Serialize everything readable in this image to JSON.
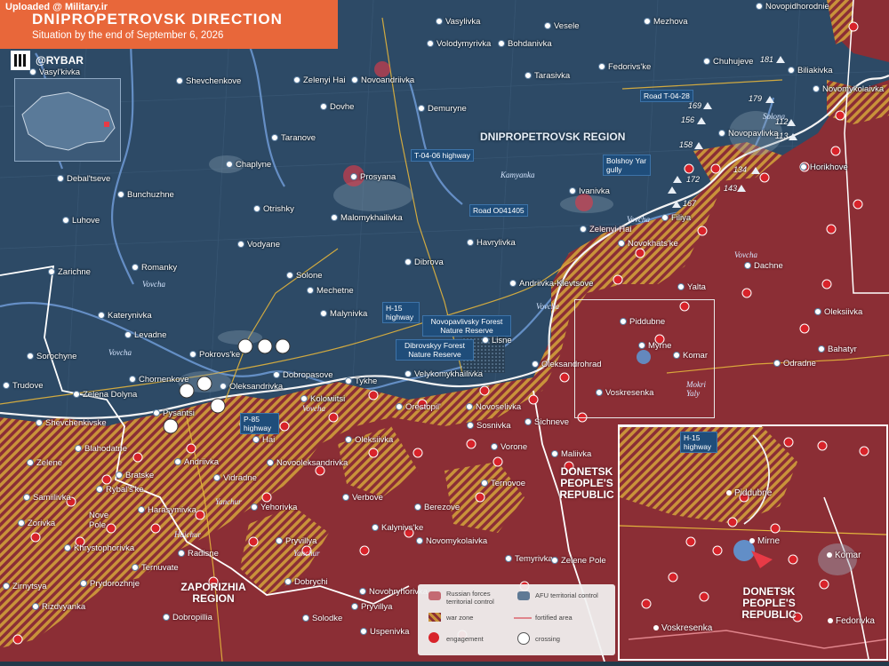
{
  "header": {
    "uploaded": "Uploaded @ Military.ir",
    "title": "DNIPROPETROVSK DIRECTION",
    "subtitle": "Situation by the end of September 6, 2026",
    "brand": "@RYBAR"
  },
  "colors": {
    "afu_territory": "#2d4a66",
    "russian_territory": "#8b2e35",
    "war_zone": "#c9923a",
    "engagement": "#d8232a",
    "header": "#e8673a",
    "roads": "#e2b43c"
  },
  "regions": {
    "dnipropetrovsk": "DNIPROPETROVSK REGION",
    "zaporizhia": "ZAPORIZHIA REGION",
    "donetsk": "DONETSK PEOPLE'S REPUBLIC"
  },
  "roads": {
    "t0406": "T-04-06 highway",
    "t0428": "Road T-04-28",
    "o041405": "Road O041405",
    "h15": "H-15 highway",
    "p85": "P-85 highway",
    "bolshoy": "Bolshoy Yar gully"
  },
  "reserves": {
    "novopavlivsky": "Novopavlivsky Forest Nature Reserve",
    "dibrovsky": "Dibrovskyy Forest Nature Reserve"
  },
  "rivers": [
    "Vovcha",
    "Vovcha",
    "Vovcha",
    "Vovcha",
    "Vovcha",
    "Vovcha",
    "Kamyanka",
    "Solona",
    "Yanchur",
    "Yanchur",
    "Haichur",
    "Mokri Yaly"
  ],
  "hill_numbers": [
    "181",
    "179",
    "169",
    "156",
    "112",
    "113",
    "158",
    "134",
    "172",
    "143",
    "167"
  ],
  "settlements": [
    "Vasyl'kivka",
    "Shevchenkove",
    "Zelenyi Hai",
    "Novoandriivka",
    "Dovhe",
    "Taranove",
    "Vasylivka",
    "Volodymyrivka",
    "Bohdanivka",
    "Vesele",
    "Mezhova",
    "Novopidhorodnie",
    "Tarasivka",
    "Fedorivs'ke",
    "Chuhujeve",
    "Biliakivka",
    "Novomykolaivka",
    "Demuryne",
    "Novopavlivka",
    "Horikhove",
    "Ivanivka",
    "Filiya",
    "Zelenyi Hai",
    "Novokhats'ke",
    "Dachne",
    "Yalta",
    "Oleksiivka",
    "Bahatyr",
    "Odradne",
    "Komar",
    "Myrne",
    "Piddubne",
    "Voskresenka",
    "Andriivka-Klevtsove",
    "Lisne",
    "Oleksandrohrad",
    "Debal'tseve",
    "Bunchuzhne",
    "Chaplyne",
    "Prosyana",
    "Otrishky",
    "Malomykhailivka",
    "Luhove",
    "Romanky",
    "Vodyane",
    "Havrylivka",
    "Dibrova",
    "Zarichne",
    "Solone",
    "Mechetne",
    "Katerynivka",
    "Levadne",
    "Malynivka",
    "Sorochyne",
    "Pokrovs'ke",
    "Trudove",
    "Chornenkove",
    "Oleksandrivka",
    "Dobropasove",
    "Tykhe",
    "Velykomykhailivka",
    "Zelena Dolyna",
    "Pysantsi",
    "Koloмiitsi",
    "Orestopil'",
    "Novoselivka",
    "Sichneve",
    "Shevchenkivske",
    "Blahodatne",
    "Zelene",
    "Hai",
    "Oleksiivka",
    "Sosnivka",
    "Vorone",
    "Maliivka",
    "Andriivka",
    "Bratske",
    "Novooleksandrivka",
    "Samiilivka",
    "Rybal's'ke",
    "Vidradne",
    "Zorivka",
    "Harasymivka",
    "Yehorivka",
    "Verbove",
    "Ternovoe",
    "Nove Pole",
    "Khrystophorivka",
    "Berezove",
    "Kalynivs'ke",
    "Novomykolaivka",
    "Pryvillya",
    "Radisne",
    "Ternuvate",
    "Temyrivka",
    "Zelene Pole",
    "Prydorozhnje",
    "Dobrychi",
    "Novohryhorivka",
    "Pryvillya",
    "Zirnytsya",
    "Rizdvyanka",
    "Dobropillia",
    "Solodke",
    "Uspenivka"
  ],
  "legend": {
    "russian": "Russian forces territorial control",
    "afu": "AFU territorial control",
    "war_zone": "war zone",
    "fortified": "fortified area",
    "engagement": "engagement",
    "crossing": "crossing"
  },
  "inset": {
    "highway": "H-15 highway",
    "settlements": [
      "Piddubne",
      "Mirne",
      "Komar",
      "Voskresenka",
      "Fedorivka"
    ],
    "region": "DONETSK PEOPLE'S REPUBLIC"
  }
}
